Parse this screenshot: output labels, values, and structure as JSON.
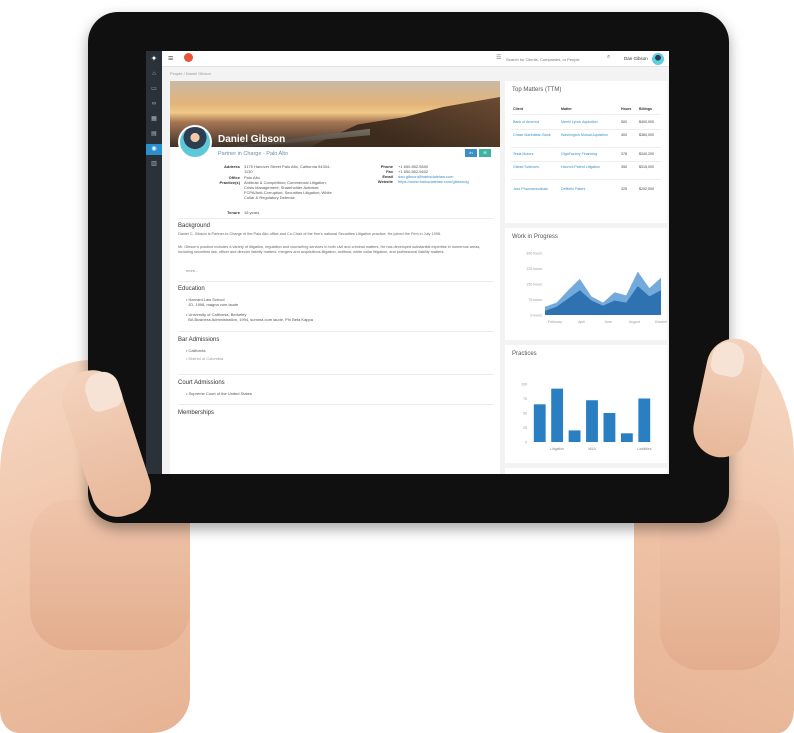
{
  "topbar": {
    "search_placeholder": "Search for Clients, Companies, or People",
    "user_name": "Dan Gibson"
  },
  "sidebar": {
    "items": [
      {
        "icon": "home-icon",
        "glyph": "⌂"
      },
      {
        "icon": "briefcase-icon",
        "glyph": "▭"
      },
      {
        "icon": "link-icon",
        "glyph": "∞"
      },
      {
        "icon": "calendar-icon",
        "glyph": "▦"
      },
      {
        "icon": "card-icon",
        "glyph": "▤"
      },
      {
        "icon": "people-icon",
        "glyph": "◉"
      },
      {
        "icon": "chart-icon",
        "glyph": "▥"
      }
    ]
  },
  "breadcrumb": "People / Daniel Gibson",
  "profile": {
    "name": "Daniel Gibson",
    "title": "Partner in Charge - Palo Alto",
    "linkedin_label": "in",
    "email_label": "✉",
    "address_key": "Address",
    "address": "3175 Hanover Street Palo Alto, California 94304-1130",
    "office_key": "Office",
    "office": "Palo Alto",
    "practices_key": "Practice(s)",
    "practices": "Antitrust & Competition; Commercial Litigation; Crisis Management; Shareholder Activism; FCPA/Anti-Corruption; Securities Litigation; White Collar & Regulatory Defense",
    "tenure_key": "Tenure",
    "tenure": "18 years",
    "phone_key": "Phone",
    "phone": "+1 650.852.5600",
    "fax_key": "Fax",
    "fax": "+1 650.852.5602",
    "email_key": "Email",
    "email": "dan.gibson@barksdalelaw.com",
    "website_key": "Website",
    "website": "https://www.barksdalelaw.com/gibsondg"
  },
  "background": {
    "title": "Background",
    "p1": "Daniel C. Gibson is Partner-in-Charge of the Palo Alto office and Co-Chair of the firm's national Securities Litigation practice. He joined the Firm in July 1998.",
    "p2": "Mr. Gibson's practice includes a variety of litigation, regulation and counseling services in both civil and criminal matters. He has developed substantial expertise in numerous areas, including securities law, officer and director liability matters, mergers and acquisitions litigation, antitrust, white collar litigation, and professional liability matters.",
    "more": "more..."
  },
  "education": {
    "title": "Education",
    "items": [
      {
        "school": "Harvard Law School",
        "detail": "JD, 1998, magna cum laude"
      },
      {
        "school": "University of California, Berkeley",
        "detail": "BA Business Administration, 1994, summa cum laude, Phi Beta Kappa"
      }
    ]
  },
  "bar": {
    "title": "Bar Admissions",
    "items": [
      "California",
      "District of Columbia"
    ]
  },
  "court": {
    "title": "Court Admissions",
    "items": [
      "Supreme Court of the United States"
    ]
  },
  "memberships": {
    "title": "Memberships"
  },
  "top_matters": {
    "title": "Top Matters (TTM)",
    "headers": [
      "Client",
      "Matter",
      "Hours",
      "Billings"
    ],
    "rows": [
      {
        "client": "Bank of America",
        "matter": "Merrill Lynch Aquisition",
        "hours": "500",
        "billings": "$400,000"
      },
      {
        "client": "Chase Manhattan Bank",
        "matter": "Washington Mutual Aquisition",
        "hours": "400",
        "billings": "$360,000"
      },
      {
        "client": "Tesla Motors",
        "matter": "GigaFactory Financing",
        "hours": "378",
        "billings": "$340,200"
      },
      {
        "client": "Gilead Sciences",
        "matter": "Harvoni Patent Litigation",
        "hours": "350",
        "billings": "$315,000"
      },
      {
        "client": "Jazz Pharmaceuticals",
        "matter": "Defitelio Patent",
        "hours": "325",
        "billings": "$292,500"
      }
    ]
  },
  "wip": {
    "title": "Work in Progress"
  },
  "practices_card": {
    "title": "Practices"
  },
  "chart_data": [
    {
      "type": "area",
      "title": "Work in Progress",
      "y_ticks": [
        "300 hours",
        "225 hours",
        "150 hours",
        "75 hours",
        "0 hours"
      ],
      "ylim": [
        0,
        300
      ],
      "x_ticks": [
        "February",
        "April",
        "June",
        "August",
        "October"
      ],
      "series": [
        {
          "values": [
            40,
            60,
            120,
            175,
            90,
            60,
            110,
            95,
            210,
            130,
            180
          ]
        },
        {
          "values": [
            20,
            40,
            80,
            120,
            70,
            45,
            70,
            60,
            140,
            90,
            120
          ]
        }
      ],
      "colors": [
        "#5b9bd5",
        "#2a6fb0"
      ]
    },
    {
      "type": "bar",
      "title": "Practices",
      "y_ticks": [
        "100",
        "75",
        "50",
        "25",
        "0"
      ],
      "ylim": [
        0,
        100
      ],
      "x_ticks": [
        "Litigation",
        "M&A",
        "Liabilities"
      ],
      "values": [
        65,
        92,
        20,
        72,
        50,
        15,
        75
      ],
      "color": "#2a7fc3"
    }
  ]
}
